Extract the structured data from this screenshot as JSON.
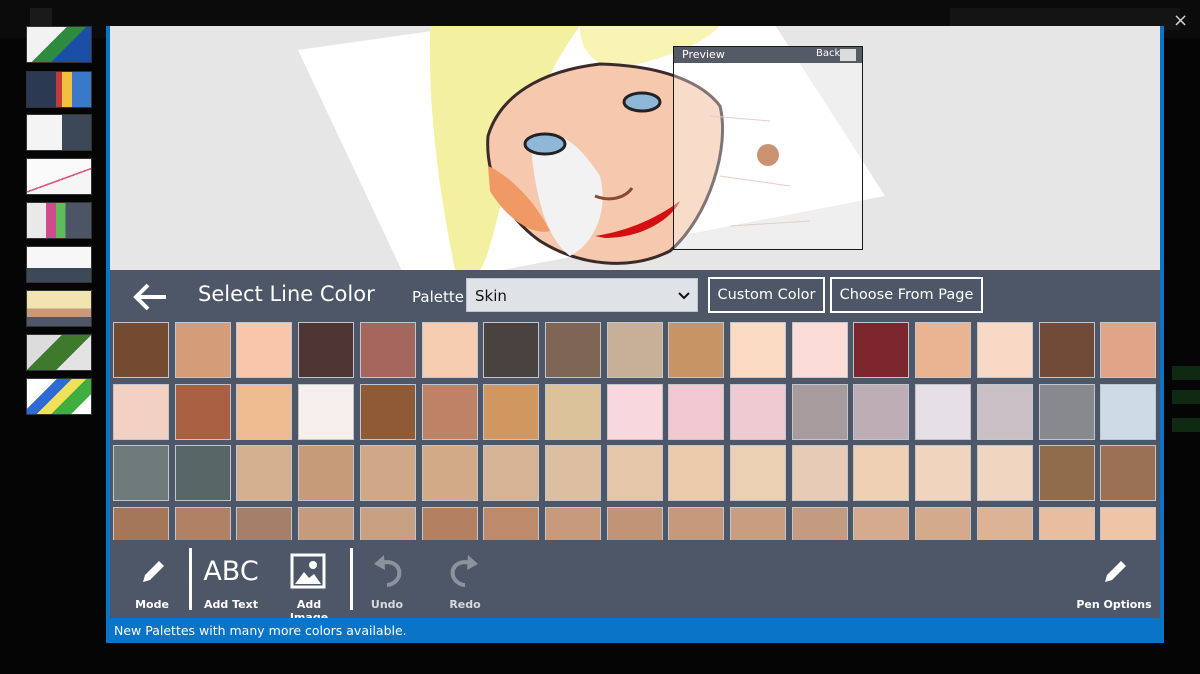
{
  "app": {
    "close_glyph": "×",
    "preview": {
      "title": "Preview",
      "back_label": "Back"
    },
    "color_panel": {
      "title": "Select Line Color",
      "palette_label": "Palette",
      "palette_value": "Skin",
      "custom_color_label": "Custom Color",
      "choose_from_page_label": "Choose From Page",
      "swatch_rows": [
        [
          "#734b31",
          "#d59c78",
          "#f9c6ab",
          "#4e3432",
          "#a4665d",
          "#f6cdb1",
          "#4a423f",
          "#7f6654",
          "#c8af97",
          "#c79565",
          "#f9dcc3",
          "#fbdcd7",
          "#7c272e",
          "#eab492",
          "#f7d9c6",
          "#714b37",
          "#e2a488"
        ],
        [
          "#f2d1c2",
          "#a95f42",
          "#efbb91",
          "#f6efec",
          "#915a36",
          "#be8367",
          "#d09860",
          "#dbc29a",
          "#f8d8dc",
          "#f2c8d0",
          "#eecad2",
          "#a89b9d",
          "#bcaeb4",
          "#e6e0e6",
          "#c9bfc5",
          "#87898c",
          "#cddbe6"
        ],
        [
          "#6f7b7b",
          "#566766",
          "#d4b091",
          "#c59b7a",
          "#d0a888",
          "#d2aa88",
          "#d6b395",
          "#dcbea0",
          "#e6c6a9",
          "#ebcbac",
          "#ecd0b4",
          "#e8cbb6",
          "#efd0b4",
          "#f1d4bd",
          "#f0d5c0",
          "#916c4c",
          "#9a7155"
        ],
        [
          "#a57759",
          "#b08263",
          "#a57f68",
          "#c59b7d",
          "#c8a183",
          "#b48062",
          "#bd8b6c",
          "#c69a7b",
          "#c09474",
          "#c5997a",
          "#c89d80",
          "#c39b80",
          "#d4ab8f",
          "#d3ab8c",
          "#ddb396",
          "#e8bda0",
          "#efc5a8"
        ]
      ]
    },
    "toolbar": {
      "mode_label": "Mode",
      "add_text_glyph": "ABC",
      "add_text_label": "Add Text",
      "add_image_label": "Add Image",
      "undo_label": "Undo",
      "redo_label": "Redo",
      "pen_options_label": "Pen Options"
    },
    "status_message": "New Palettes with many more colors available."
  }
}
